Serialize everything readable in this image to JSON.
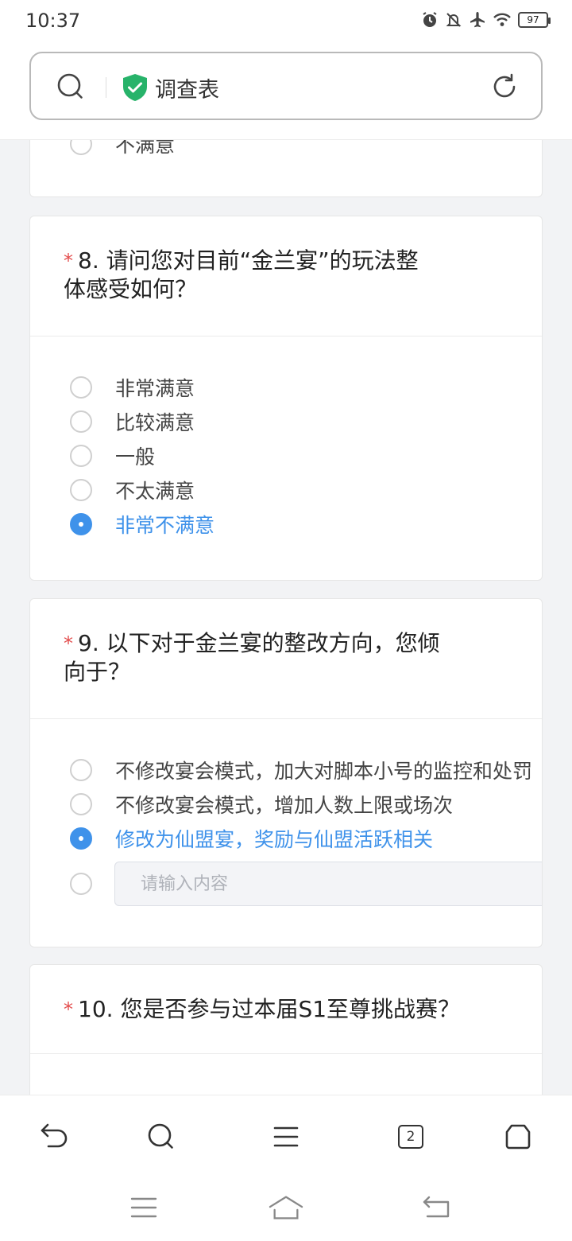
{
  "status_bar": {
    "time": "10:37",
    "battery": "97",
    "icons": [
      "alarm-icon",
      "notifications-off-icon",
      "airplane-mode-icon",
      "wifi-icon",
      "battery-icon"
    ]
  },
  "address_bar": {
    "title": "调查表",
    "icons": [
      "search-icon",
      "secure-shield-icon",
      "refresh-icon"
    ],
    "accent": "#27b36a"
  },
  "prev_card": {
    "partial_option": "不满意"
  },
  "questions": [
    {
      "required_mark": "*",
      "number": "8.",
      "title_line1": "请问您对目前“金兰宴”的玩法整",
      "title_line2": "体感受如何？",
      "options": [
        {
          "label": "非常满意",
          "selected": false
        },
        {
          "label": "比较满意",
          "selected": false
        },
        {
          "label": "一般",
          "selected": false
        },
        {
          "label": "不太满意",
          "selected": false
        },
        {
          "label": "非常不满意",
          "selected": true
        }
      ]
    },
    {
      "required_mark": "*",
      "number": "9.",
      "title_line1": "以下对于金兰宴的整改方向，您倾",
      "title_line2": "向于？",
      "options": [
        {
          "label": "不修改宴会模式，加大对脚本小号的监控和处罚",
          "selected": false
        },
        {
          "label": "不修改宴会模式，增加人数上限或场次",
          "selected": false
        },
        {
          "label": "修改为仙盟宴，奖励与仙盟活跃相关",
          "selected": true
        }
      ],
      "other_placeholder": "请输入内容"
    },
    {
      "required_mark": "*",
      "number": "10.",
      "title_line1": "您是否参与过本届S1至尊挑战赛？"
    }
  ],
  "bottom_nav": {
    "tab_count": "2",
    "icons": [
      "back-icon",
      "search-icon",
      "menu-icon",
      "tabs-icon",
      "home-icon"
    ]
  },
  "system_nav": {
    "icons": [
      "recents-icon",
      "home-icon",
      "back-icon"
    ]
  },
  "colors": {
    "accent_blue": "#3f92ea",
    "required_red": "#e34d4d",
    "background": "#f2f3f5"
  }
}
